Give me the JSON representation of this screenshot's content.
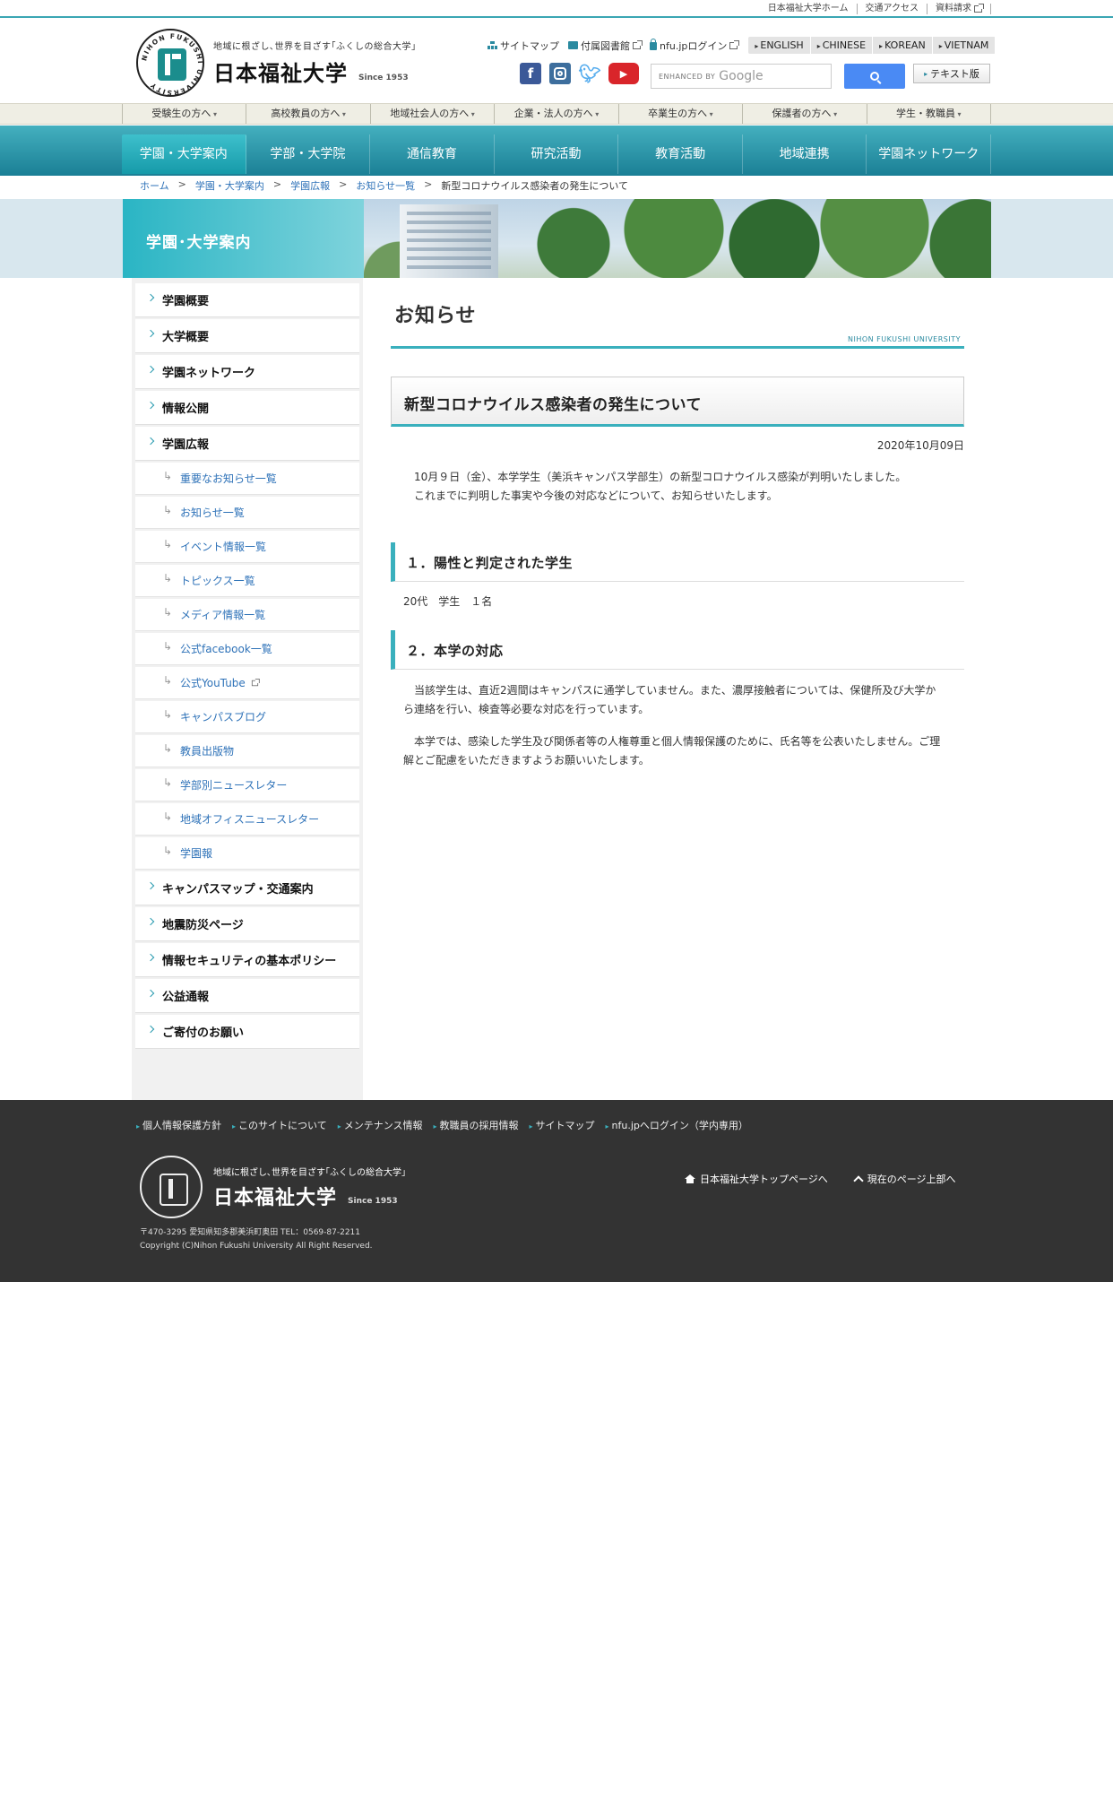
{
  "top_links": [
    "日本福祉大学ホーム",
    "交通アクセス",
    "資料請求"
  ],
  "header": {
    "tagline": "地域に根ざし､世界を目ざす｢ふくしの総合大学｣",
    "name": "日本福祉大学",
    "since": "Since 1953",
    "seal_text": "NIHON FUKUSHI UNIVERSITY",
    "util_links": {
      "sitemap": "サイトマップ",
      "library": "付属図書館",
      "login": "nfu.jpログイン"
    },
    "languages": [
      "ENGLISH",
      "CHINESE",
      "KOREAN",
      "VIETNAM"
    ],
    "search": {
      "enhanced": "ENHANCED BY",
      "google": "Google"
    },
    "text_version": "テキスト版",
    "social_icons": [
      "facebook-icon",
      "instagram-icon",
      "twitter-icon",
      "youtube-icon"
    ]
  },
  "audience": [
    "受験生の方へ",
    "高校教員の方へ",
    "地域社会人の方へ",
    "企業・法人の方へ",
    "卒業生の方へ",
    "保護者の方へ",
    "学生・教職員"
  ],
  "nav": [
    "学園・大学案内",
    "学部・大学院",
    "通信教育",
    "研究活動",
    "教育活動",
    "地域連携",
    "学園ネットワーク"
  ],
  "breadcrumb": {
    "home": "ホーム",
    "about": "学園・大学案内",
    "pr": "学園広報",
    "news": "お知らせ一覧",
    "current": "新型コロナウイルス感染者の発生について"
  },
  "hero": {
    "label": "学園･大学案内"
  },
  "sidebar": {
    "main_top": [
      "学園概要",
      "大学概要",
      "学園ネットワーク",
      "情報公開",
      "学園広報"
    ],
    "sub": [
      "重要なお知らせ一覧",
      "お知らせ一覧",
      "イベント情報一覧",
      "トピックス一覧",
      "メディア情報一覧",
      "公式facebook一覧",
      "公式YouTube",
      "キャンパスブログ",
      "教員出版物",
      "学部別ニュースレター",
      "地域オフィスニュースレター",
      "学園報"
    ],
    "main_bottom": [
      "キャンパスマップ・交通案内",
      "地震防災ページ",
      "情報セキュリティの基本ポリシー",
      "公益通報",
      "ご寄付のお願い"
    ]
  },
  "content": {
    "section_title": "お知らせ",
    "section_sub": "NIHON FUKUSHI UNIVERSITY",
    "article_title": "新型コロナウイルス感染者の発生について",
    "date": "2020年10月09日",
    "intro": [
      "10月９日（金）、本学学生（美浜キャンパス学部生）の新型コロナウイルス感染が判明いたしました。",
      "これまでに判明した事実や今後の対応などについて、お知らせいたします。"
    ],
    "h1": "１．陽性と判定された学生",
    "h1_body": "20代　学生　１名",
    "h2": "２．本学の対応",
    "h2_body": [
      "当該学生は、直近2週間はキャンパスに通学していません。また、濃厚接触者については、保健所及び大学から連絡を行い、検査等必要な対応を行っています。",
      "本学では、感染した学生及び関係者等の人権尊重と個人情報保護のために、氏名等を公表いたしません。ご理解とご配慮をいただきますようお願いいたします。"
    ]
  },
  "footer": {
    "links": [
      "個人情報保護方針",
      "このサイトについて",
      "メンテナンス情報",
      "教職員の採用情報",
      "サイトマップ",
      "nfu.jpへログイン（学内専用）"
    ],
    "tagline": "地域に根ざし､世界を目ざす｢ふくしの総合大学｣",
    "name": "日本福祉大学",
    "since": "Since 1953",
    "address": "〒470-3295 愛知県知多郡美浜町奥田 TEL：0569-87-2211",
    "copyright": "Copyright (C)Nihon Fukushi University All Right Reserved.",
    "top_page": "日本福祉大学トップページへ",
    "page_top": "現在のページ上部へ"
  }
}
